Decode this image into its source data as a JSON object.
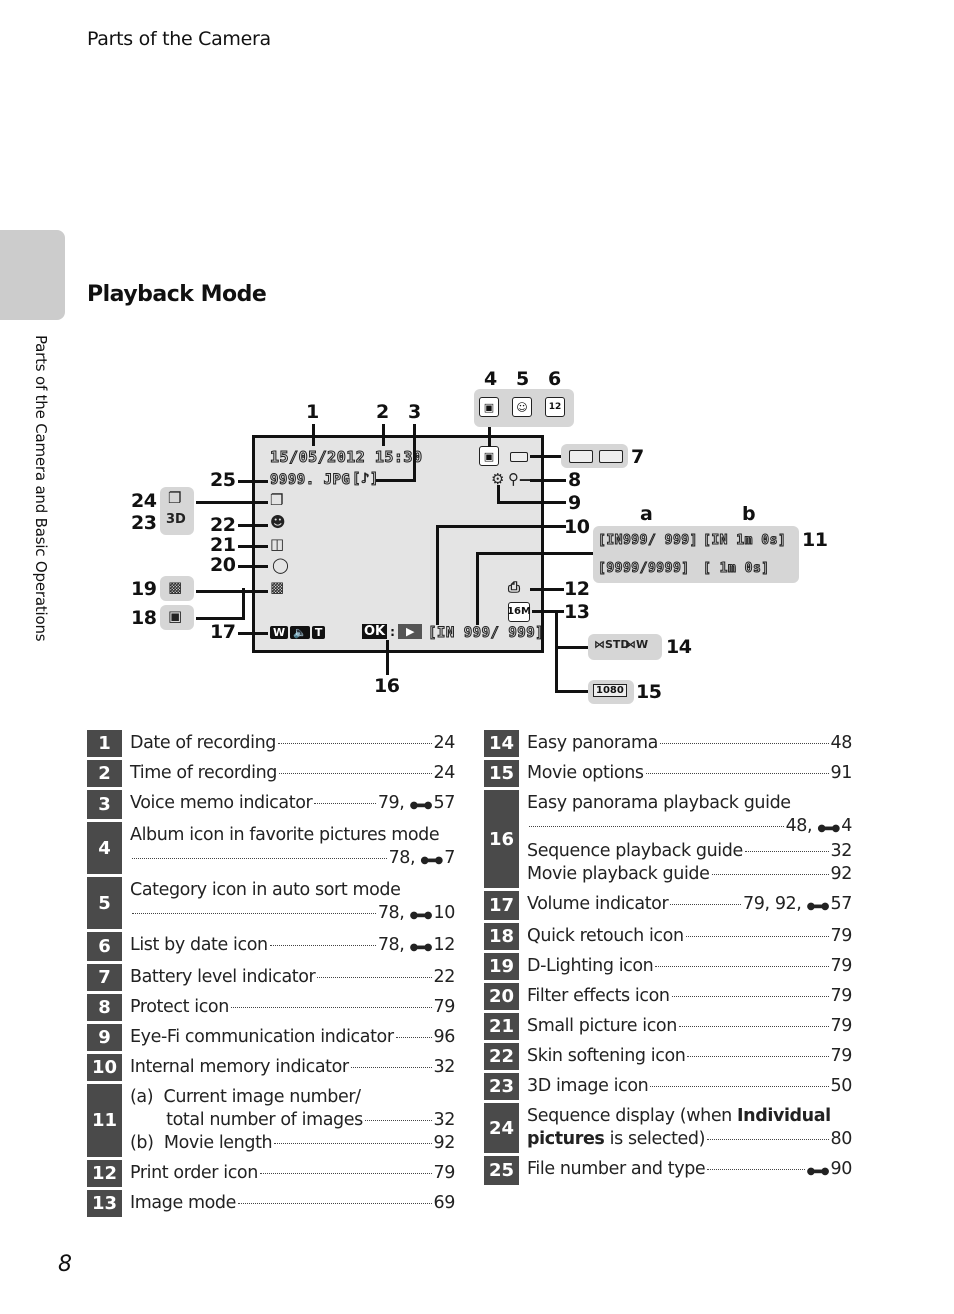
{
  "header": {
    "running_title": "Parts of the Camera"
  },
  "side_tab": {
    "label": "Parts of the Camera and Basic Operations"
  },
  "section": {
    "title": "Playback Mode"
  },
  "page_number": "8",
  "diagram": {
    "callouts": [
      "1",
      "2",
      "3",
      "4",
      "5",
      "6",
      "7",
      "8",
      "9",
      "10",
      "11",
      "12",
      "13",
      "14",
      "15",
      "16",
      "17",
      "18",
      "19",
      "20",
      "21",
      "22",
      "23",
      "24",
      "25"
    ],
    "sub_labels": {
      "a": "a",
      "b": "b"
    },
    "screen": {
      "date_time": "15/05/2012 15:30",
      "file_name": "9999. JPG",
      "voice_memo_glyph": "[♪]",
      "image_counter": "[IN 999/  999]",
      "ok_label": "OK",
      "image_mode": "16M",
      "volume_w": "W",
      "volume_t": "T"
    },
    "indicator_11": {
      "row1_a": "[IN999/  999]",
      "row1_b": "[IN   1m 0s]",
      "row2_a": "[9999/9999]",
      "row2_b": "[    1m 0s]"
    },
    "icons_4_5_6": [
      "album-icon",
      "category-icon",
      "list-by-date-icon"
    ],
    "icons_7": [
      "battery-full-icon",
      "battery-low-icon"
    ],
    "icons_14": [
      "easy-panorama-std-icon",
      "easy-panorama-wide-icon"
    ],
    "icon_15": "1080",
    "icon_23": "3D",
    "icon_6_text": "12"
  },
  "table_left": [
    {
      "num": "1",
      "lines": [
        {
          "label": "Date of recording",
          "page": "24"
        }
      ]
    },
    {
      "num": "2",
      "lines": [
        {
          "label": "Time of recording",
          "page": "24"
        }
      ]
    },
    {
      "num": "3",
      "lines": [
        {
          "label": "Voice memo indicator",
          "page": "79, ",
          "ref": "57"
        }
      ]
    },
    {
      "num": "4",
      "lines": [
        {
          "label": "Album icon in favorite pictures mode",
          "page_only": true
        },
        {
          "label": "",
          "page": "78, ",
          "ref": "7"
        }
      ]
    },
    {
      "num": "5",
      "lines": [
        {
          "label": "Category icon in auto sort mode",
          "page_only": true
        },
        {
          "label": "",
          "page": "78, ",
          "ref": "10"
        }
      ]
    },
    {
      "num": "6",
      "lines": [
        {
          "label": "List by date icon",
          "page": "78, ",
          "ref": "12"
        }
      ]
    },
    {
      "num": "7",
      "lines": [
        {
          "label": "Battery level indicator",
          "page": "22"
        }
      ]
    },
    {
      "num": "8",
      "lines": [
        {
          "label": "Protect icon",
          "page": "79"
        }
      ]
    },
    {
      "num": "9",
      "lines": [
        {
          "label": "Eye-Fi communication indicator",
          "page": "96"
        }
      ]
    },
    {
      "num": "10",
      "lines": [
        {
          "label": "Internal memory indicator",
          "page": "32"
        }
      ]
    },
    {
      "num": "11",
      "lines": [
        {
          "label": "(a)  Current image number/",
          "page_only": true
        },
        {
          "label": "       total number of images",
          "page": "32"
        },
        {
          "label": "(b)  Movie length",
          "page": "92"
        }
      ]
    },
    {
      "num": "12",
      "lines": [
        {
          "label": "Print order icon",
          "page": "79"
        }
      ]
    },
    {
      "num": "13",
      "lines": [
        {
          "label": "Image mode",
          "page": "69"
        }
      ]
    }
  ],
  "table_right": [
    {
      "num": "14",
      "lines": [
        {
          "label": "Easy panorama",
          "page": "48"
        }
      ]
    },
    {
      "num": "15",
      "lines": [
        {
          "label": "Movie options",
          "page": "91"
        }
      ]
    },
    {
      "num": "16",
      "lines": [
        {
          "label": "Easy panorama playback guide",
          "page_only": true
        },
        {
          "label": "",
          "page": "48, ",
          "ref": "4"
        },
        {
          "label": "Sequence playback guide",
          "page": "32"
        },
        {
          "label": "Movie playback guide",
          "page": "92"
        }
      ]
    },
    {
      "num": "17",
      "lines": [
        {
          "label": "Volume indicator",
          "page": "79, 92, ",
          "ref": "57"
        }
      ]
    },
    {
      "num": "18",
      "lines": [
        {
          "label": "Quick retouch icon",
          "page": "79"
        }
      ]
    },
    {
      "num": "19",
      "lines": [
        {
          "label": "D-Lighting icon",
          "page": "79"
        }
      ]
    },
    {
      "num": "20",
      "lines": [
        {
          "label": "Filter effects icon",
          "page": "79"
        }
      ]
    },
    {
      "num": "21",
      "lines": [
        {
          "label": "Small picture icon",
          "page": "79"
        }
      ]
    },
    {
      "num": "22",
      "lines": [
        {
          "label": "Skin softening icon",
          "page": "79"
        }
      ]
    },
    {
      "num": "23",
      "lines": [
        {
          "label": "3D image icon",
          "page": "50"
        }
      ]
    },
    {
      "num": "24",
      "lines": [
        {
          "label": "Sequence display (when ",
          "bold": "Individual",
          "page_only": true
        },
        {
          "label": "",
          "bold_prefix": "pictures",
          "label_after": " is selected)",
          "page": "80"
        }
      ]
    },
    {
      "num": "25",
      "lines": [
        {
          "label": "File number and type",
          "page": "",
          "ref": "90"
        }
      ]
    }
  ]
}
